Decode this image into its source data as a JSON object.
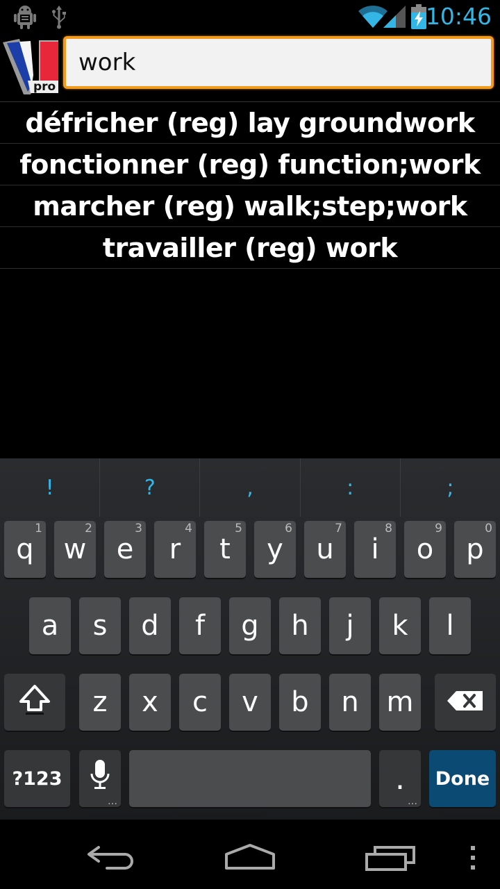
{
  "status_bar": {
    "time": "10:46",
    "icons": [
      "android-debug-icon",
      "usb-icon",
      "wifi-icon",
      "signal-icon",
      "battery-charging-icon"
    ]
  },
  "header": {
    "logo_text": "pro",
    "search_value": "work",
    "accent_color": "#f39b1e"
  },
  "results": [
    "défricher (reg) lay groundwork",
    "fonctionner (reg) function;work",
    "marcher (reg) walk;step;work",
    "travailler (reg) work"
  ],
  "keyboard": {
    "suggestions": [
      "!",
      "?",
      ",",
      ":",
      ";"
    ],
    "row1": [
      {
        "k": "q",
        "h": "1"
      },
      {
        "k": "w",
        "h": "2"
      },
      {
        "k": "e",
        "h": "3"
      },
      {
        "k": "r",
        "h": "4"
      },
      {
        "k": "t",
        "h": "5"
      },
      {
        "k": "y",
        "h": "6"
      },
      {
        "k": "u",
        "h": "7"
      },
      {
        "k": "i",
        "h": "8"
      },
      {
        "k": "o",
        "h": "9"
      },
      {
        "k": "p",
        "h": "0"
      }
    ],
    "row2": [
      "a",
      "s",
      "d",
      "f",
      "g",
      "h",
      "j",
      "k",
      "l"
    ],
    "row3": [
      "z",
      "x",
      "c",
      "v",
      "b",
      "n",
      "m"
    ],
    "symbols_label": "?123",
    "period_label": ".",
    "done_label": "Done"
  }
}
